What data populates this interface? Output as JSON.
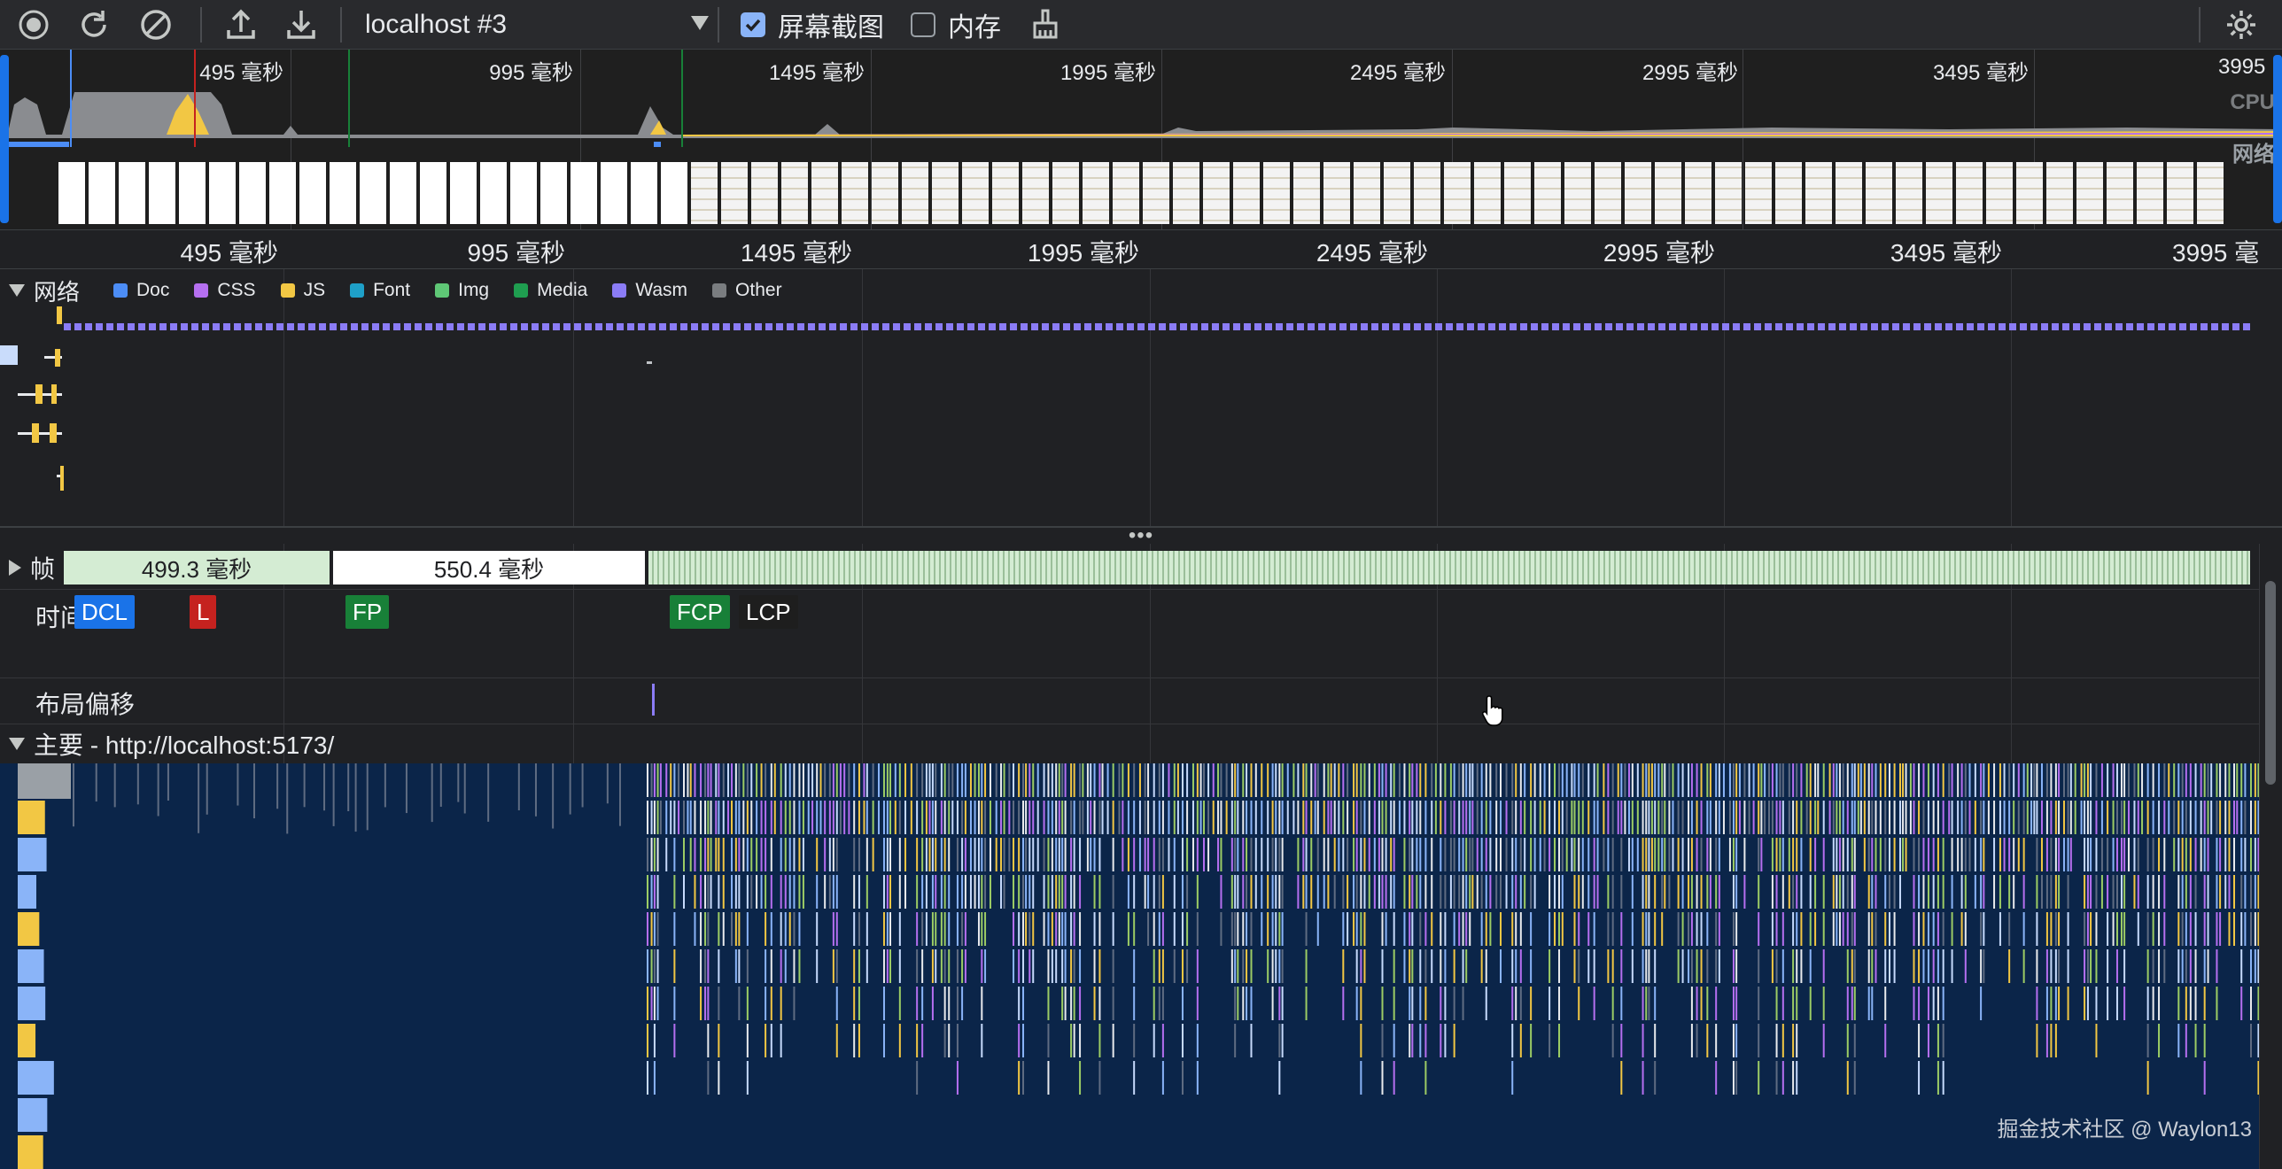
{
  "toolbar": {
    "target": "localhost #3",
    "screenshots_label": "屏幕截图",
    "screenshots_checked": true,
    "memory_label": "内存",
    "memory_checked": false,
    "icons": [
      "record-icon",
      "reload-icon",
      "clear-icon",
      "upload-icon",
      "download-icon",
      "broom-icon",
      "gear-icon"
    ]
  },
  "overview": {
    "tick_labels": [
      "495 毫秒",
      "995 毫秒",
      "1495 毫秒",
      "1995 毫秒",
      "2495 毫秒",
      "2995 毫秒",
      "3495 毫秒",
      "3995"
    ],
    "cpu_label": "CPU",
    "net_label": "网络"
  },
  "ruler": {
    "tick_labels": [
      "495 毫秒",
      "995 毫秒",
      "1495 毫秒",
      "1995 毫秒",
      "2495 毫秒",
      "2995 毫秒",
      "3495 毫秒",
      "3995 毫"
    ]
  },
  "network": {
    "title": "网络",
    "legend": [
      {
        "label": "Doc",
        "color": "#4c8df6"
      },
      {
        "label": "CSS",
        "color": "#b56ff0"
      },
      {
        "label": "JS",
        "color": "#f2c744"
      },
      {
        "label": "Font",
        "color": "#1ea0c8"
      },
      {
        "label": "Img",
        "color": "#5fc776"
      },
      {
        "label": "Media",
        "color": "#1f9e50"
      },
      {
        "label": "Wasm",
        "color": "#8b7cf6"
      },
      {
        "label": "Other",
        "color": "#7a7d80"
      }
    ]
  },
  "tracks": {
    "frames_title": "帧",
    "frames": [
      "499.3 毫秒",
      "550.4 毫秒"
    ],
    "timings_title": "时间",
    "markers": [
      {
        "label": "DCL",
        "color": "#1a73e8"
      },
      {
        "label": "L",
        "color": "#c5221f"
      },
      {
        "label": "FP",
        "color": "#188038"
      },
      {
        "label": "FCP",
        "color": "#188038"
      },
      {
        "label": "LCP",
        "color": "#1e1e1e"
      }
    ],
    "layout_shifts_title": "布局偏移",
    "main_title": "主要 - http://localhost:5173/"
  },
  "watermark": "掘金技术社区 @ Waylon13"
}
